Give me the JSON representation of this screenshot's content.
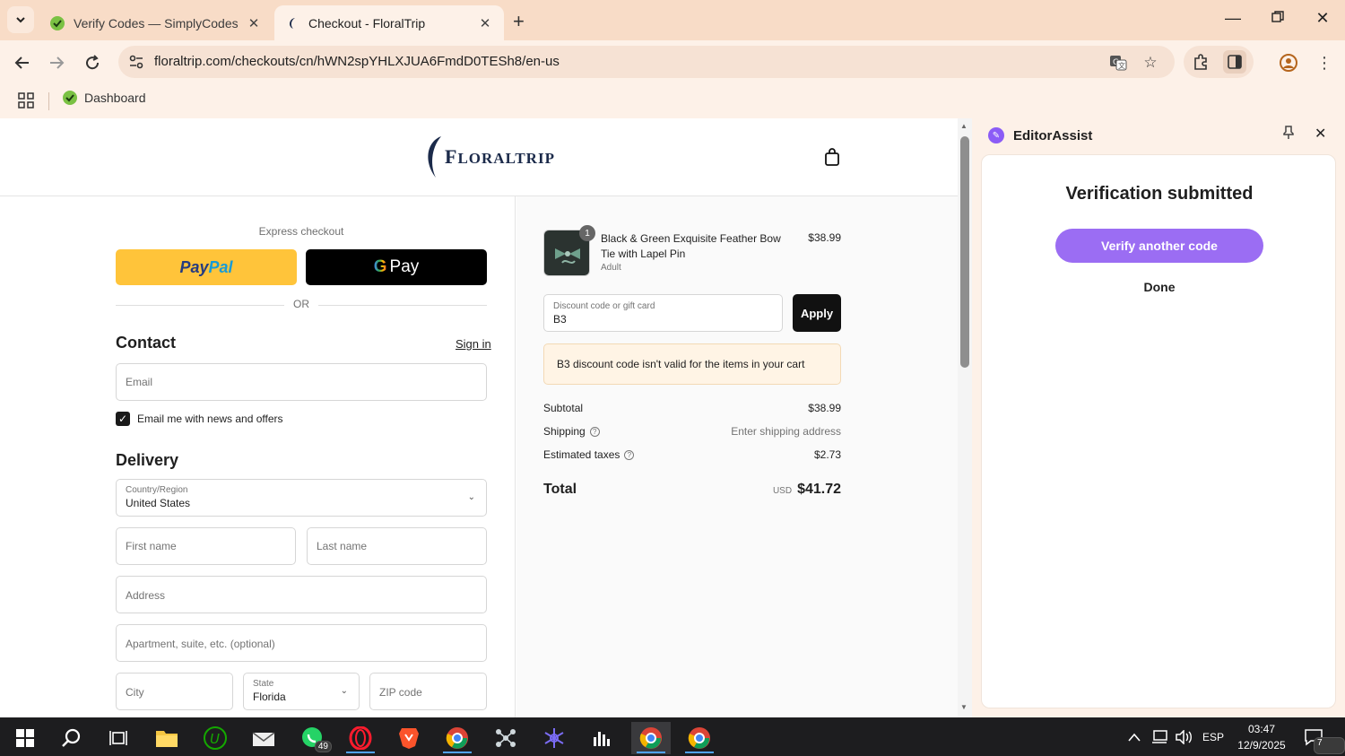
{
  "browser": {
    "tabs": [
      {
        "title": "Verify Codes — SimplyCodes",
        "active": false
      },
      {
        "title": "Checkout - FloralTrip",
        "active": true
      }
    ],
    "url": "floraltrip.com/checkouts/cn/hWN2spYHLXJUA6FmdD0TESh8/en-us",
    "bookmarks": [
      {
        "label": "Dashboard"
      }
    ]
  },
  "site": {
    "logo_initial": "F",
    "logo_text": "LORALTRIP"
  },
  "checkout": {
    "express_label": "Express checkout",
    "paypal_part1": "Pay",
    "paypal_part2": "Pal",
    "gpay_g": "G",
    "gpay_label": "Pay",
    "or_label": "OR",
    "contact": {
      "title": "Contact",
      "sign_in": "Sign in",
      "email_placeholder": "Email",
      "newsletter_label": "Email me with news and offers",
      "newsletter_checked": true
    },
    "delivery": {
      "title": "Delivery",
      "country_label": "Country/Region",
      "country_value": "United States",
      "first_name_placeholder": "First name",
      "last_name_placeholder": "Last name",
      "address_placeholder": "Address",
      "apartment_placeholder": "Apartment, suite, etc. (optional)",
      "city_placeholder": "City",
      "state_label": "State",
      "state_value": "Florida",
      "zip_placeholder": "ZIP code"
    }
  },
  "summary": {
    "item": {
      "quantity": "1",
      "name": "Black & Green Exquisite Feather Bow Tie with Lapel Pin",
      "variant": "Adult",
      "price": "$38.99"
    },
    "discount_label": "Discount code or gift card",
    "discount_value": "B3",
    "apply_label": "Apply",
    "error_message": "B3 discount code isn't valid for the items in your cart",
    "subtotal_label": "Subtotal",
    "subtotal_value": "$38.99",
    "shipping_label": "Shipping",
    "shipping_value": "Enter shipping address",
    "taxes_label": "Estimated taxes",
    "taxes_value": "$2.73",
    "total_label": "Total",
    "total_currency": "USD",
    "total_value": "$41.72"
  },
  "sidepanel": {
    "title": "EditorAssist",
    "heading": "Verification submitted",
    "primary_button": "Verify another code",
    "secondary_button": "Done"
  },
  "taskbar": {
    "whatsapp_badge": "49",
    "language": "ESP",
    "time": "03:47",
    "date": "12/9/2025",
    "notifications": "7"
  },
  "colors": {
    "chrome_bg": "#f8dcc7",
    "accent_purple": "#9b6df3",
    "paypal_yellow": "#ffc43a",
    "error_bg": "#fff4e5"
  }
}
